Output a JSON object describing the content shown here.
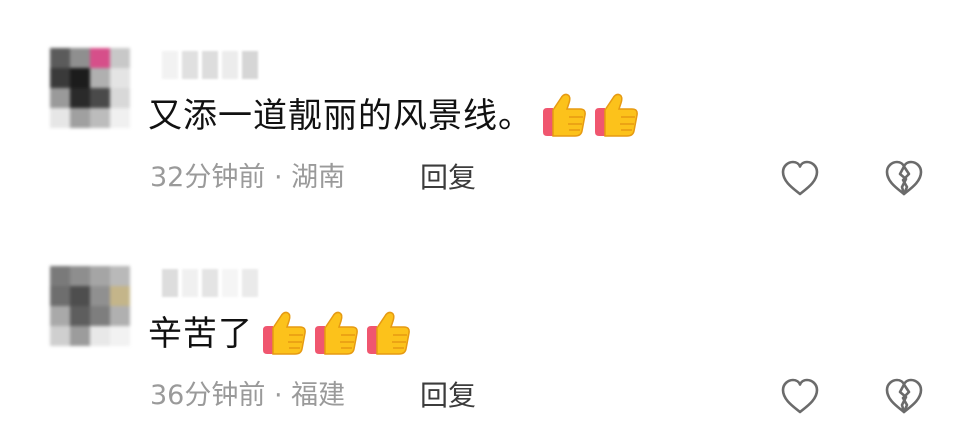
{
  "comments": [
    {
      "text": "又添一道靓丽的风景线。",
      "thumbs": 2,
      "time": "32分钟前",
      "separator": "·",
      "location": "湖南",
      "reply_label": "回复",
      "like_icon": "heart-outline-icon",
      "dislike_icon": "broken-heart-icon",
      "avatar_colors": [
        "#5b5b5b",
        "#8f8f8f",
        "#d64f8a",
        "#c8c8c8",
        "#3a3a3a",
        "#1c1c1c",
        "#b0b0b0",
        "#e4e4e4",
        "#9a9a9a",
        "#2a2a2a",
        "#4a4a4a",
        "#d8d8d8",
        "#e6e6e6",
        "#a0a0a0",
        "#bcbcbc",
        "#f0f0f0"
      ],
      "nick_colors": [
        "#f2f2f2",
        "#e0e0e0",
        "#dddddd",
        "#ececec",
        "#d6d6d6"
      ]
    },
    {
      "text": "辛苦了",
      "thumbs": 3,
      "time": "36分钟前",
      "separator": "·",
      "location": "福建",
      "reply_label": "回复",
      "like_icon": "heart-outline-icon",
      "dislike_icon": "broken-heart-icon",
      "avatar_colors": [
        "#7a7a7a",
        "#8e8e8e",
        "#a5a5a5",
        "#b9b9b9",
        "#6e6e6e",
        "#4e4e4e",
        "#909090",
        "#c4b58a",
        "#a9a9a9",
        "#5e5e5e",
        "#7e7e7e",
        "#b0b0b0",
        "#cfcfcf",
        "#9c9c9c",
        "#e8e8e8",
        "#f2f2f2"
      ],
      "nick_colors": [
        "#dddddd",
        "#f0f0f0",
        "#e4e4e4",
        "#f5f5f5",
        "#eaeaea"
      ]
    }
  ]
}
